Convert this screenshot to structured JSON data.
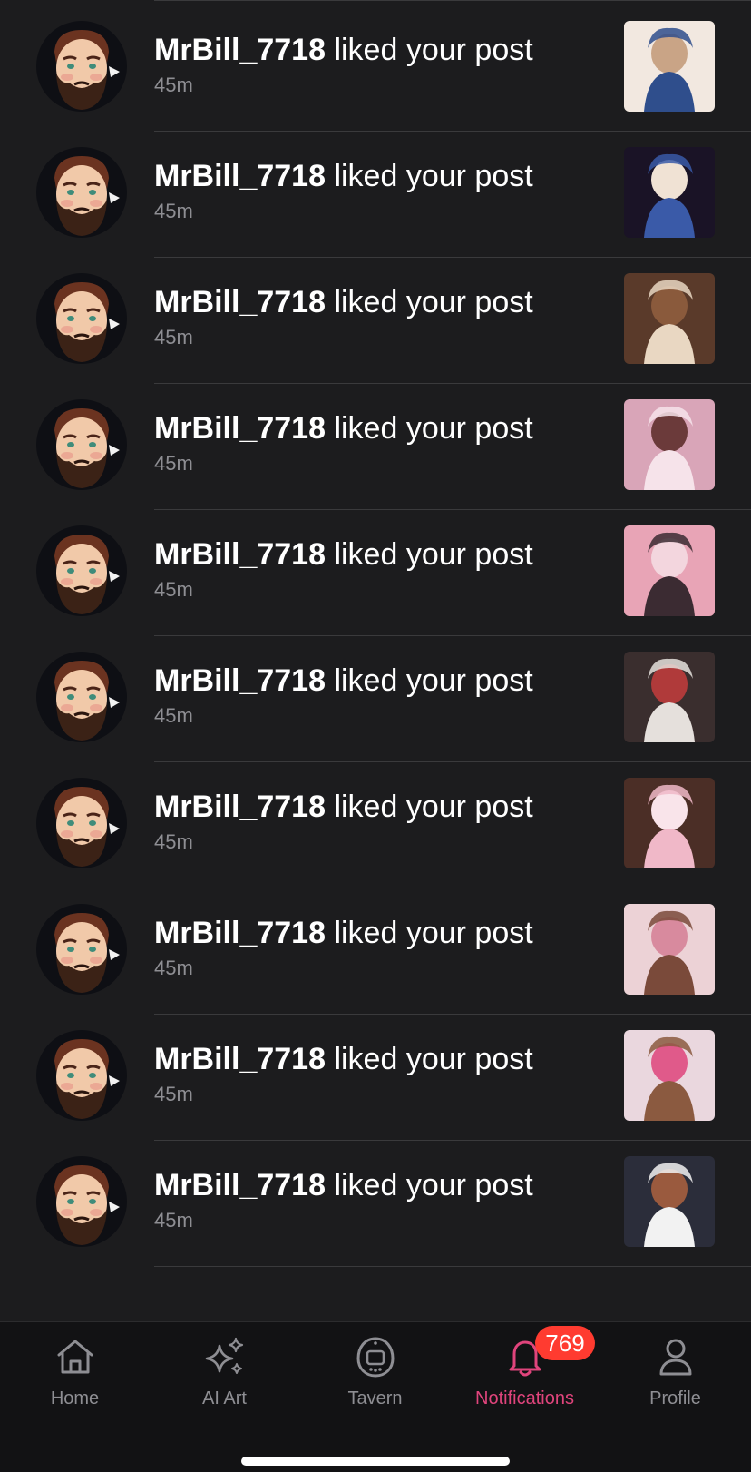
{
  "notifications": [
    {
      "username": "MrBill_7718",
      "action": "liked your post",
      "time": "45m"
    },
    {
      "username": "MrBill_7718",
      "action": "liked your post",
      "time": "45m"
    },
    {
      "username": "MrBill_7718",
      "action": "liked your post",
      "time": "45m"
    },
    {
      "username": "MrBill_7718",
      "action": "liked your post",
      "time": "45m"
    },
    {
      "username": "MrBill_7718",
      "action": "liked your post",
      "time": "45m"
    },
    {
      "username": "MrBill_7718",
      "action": "liked your post",
      "time": "45m"
    },
    {
      "username": "MrBill_7718",
      "action": "liked your post",
      "time": "45m"
    },
    {
      "username": "MrBill_7718",
      "action": "liked your post",
      "time": "45m"
    },
    {
      "username": "MrBill_7718",
      "action": "liked your post",
      "time": "45m"
    },
    {
      "username": "MrBill_7718",
      "action": "liked your post",
      "time": "45m"
    }
  ],
  "tabbar": {
    "items": [
      {
        "label": "Home",
        "icon": "home-icon"
      },
      {
        "label": "AI Art",
        "icon": "sparkles-icon"
      },
      {
        "label": "Tavern",
        "icon": "tamagotchi-icon"
      },
      {
        "label": "Notifications",
        "icon": "bell-icon",
        "active": true,
        "badge": "769"
      },
      {
        "label": "Profile",
        "icon": "person-icon"
      }
    ]
  },
  "colors": {
    "background": "#1c1c1e",
    "accent": "#e0447c",
    "badge": "#ff3b30",
    "muted": "#8e8e93"
  }
}
